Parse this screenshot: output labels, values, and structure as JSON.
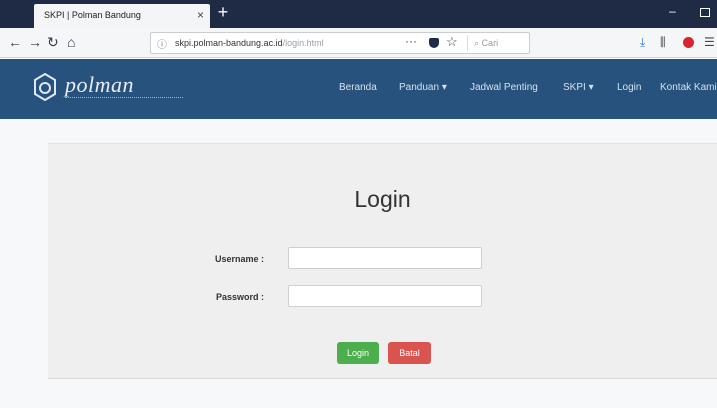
{
  "browser": {
    "tab_title": "SKPI | Polman Bandung",
    "tab_close": "×",
    "new_tab": "+",
    "minimize": "–",
    "back": "←",
    "forward": "→",
    "reload": "↻",
    "home": "⌂",
    "url_info": "ⓘ",
    "url_host": "skpi.polman-bandung.ac.id",
    "url_path": "/login.html",
    "url_more": "···",
    "url_star": "☆",
    "search_placeholder": "Cari",
    "download_icon": "⤓",
    "library_icon": "⫼"
  },
  "site": {
    "logo_text": "polman",
    "nav": [
      "Beranda",
      "Panduan ▾",
      "Jadwal Penting",
      "SKPI ▾",
      "Login",
      "Kontak Kami"
    ]
  },
  "login": {
    "title": "Login",
    "username_label": "Username :",
    "password_label": "Password :",
    "username_value": "",
    "password_value": "",
    "login_button": "Login",
    "cancel_button": "Batal"
  },
  "colors": {
    "header": "#26527d",
    "login_button": "#4cae4c",
    "cancel_button": "#d9534f"
  }
}
